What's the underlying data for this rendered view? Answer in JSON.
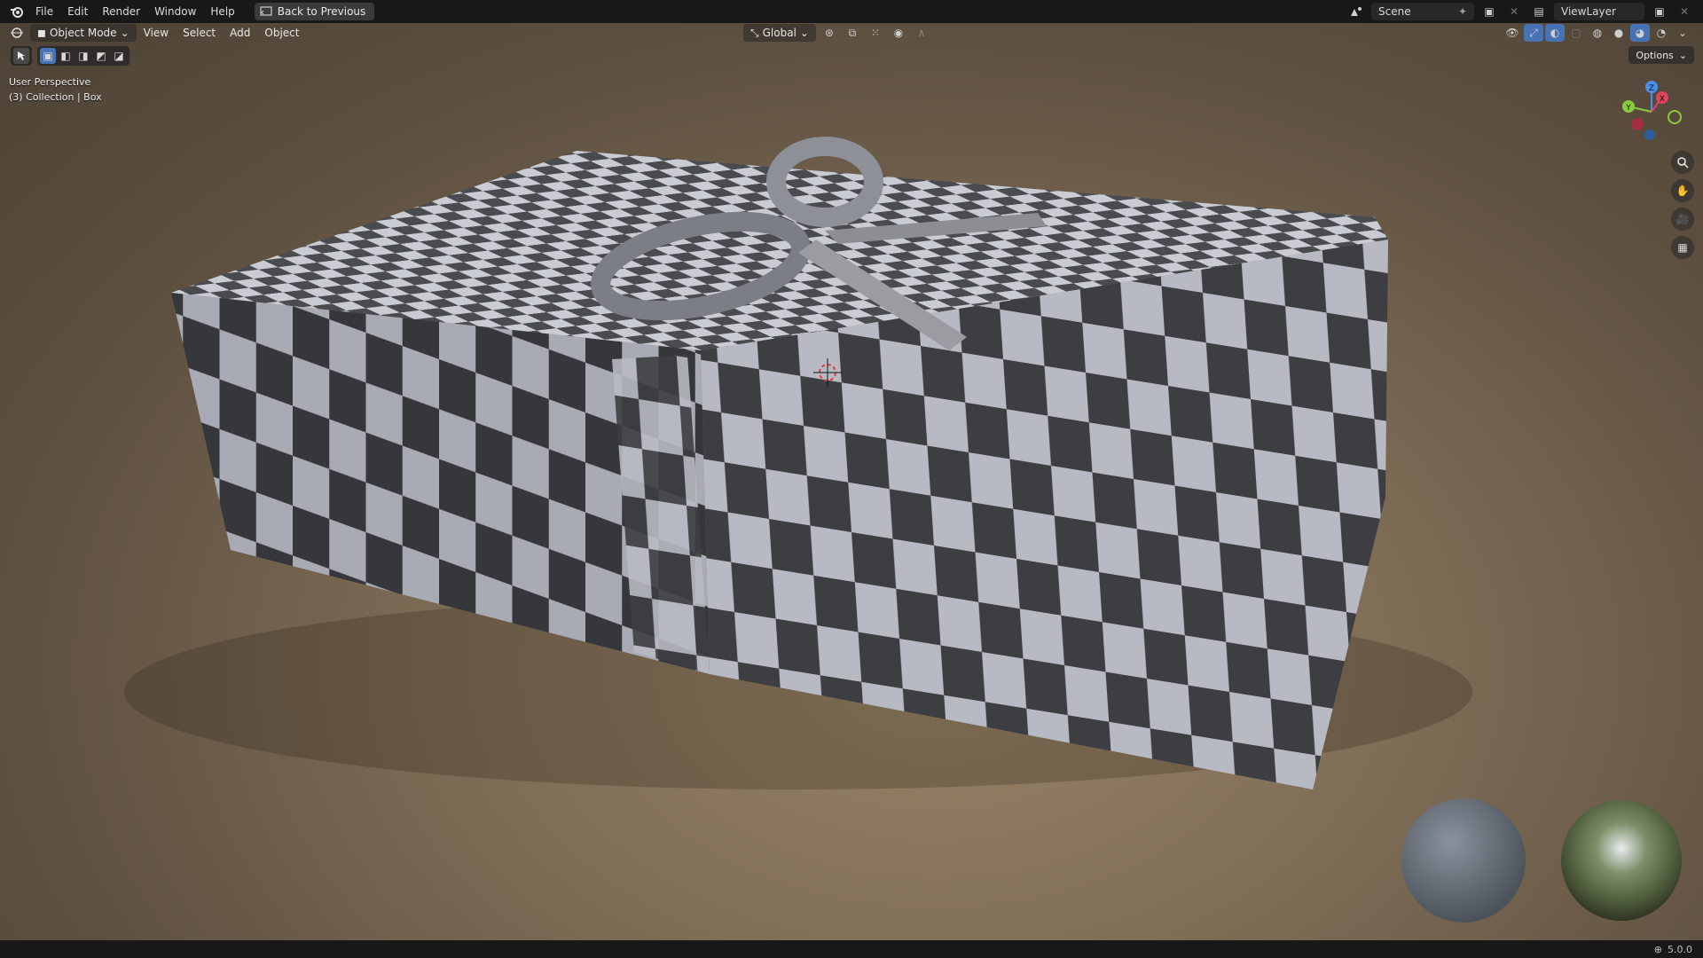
{
  "topbar": {
    "menus": [
      "File",
      "Edit",
      "Render",
      "Window",
      "Help"
    ],
    "back_button": "Back to Previous",
    "scene_name": "Scene",
    "view_layer": "ViewLayer"
  },
  "viewport_header": {
    "mode": "Object Mode",
    "menus": [
      "View",
      "Select",
      "Add",
      "Object"
    ],
    "transform_orientation": "Global",
    "options_label": "Options"
  },
  "overlay": {
    "perspective": "User Perspective",
    "collection": "(3) Collection | Box"
  },
  "gizmo": {
    "z": "Z",
    "y": "Y",
    "x": "X"
  },
  "status": {
    "version": "5.0.0"
  },
  "colors": {
    "accent": "#4772b3",
    "background_top": "#181818"
  }
}
